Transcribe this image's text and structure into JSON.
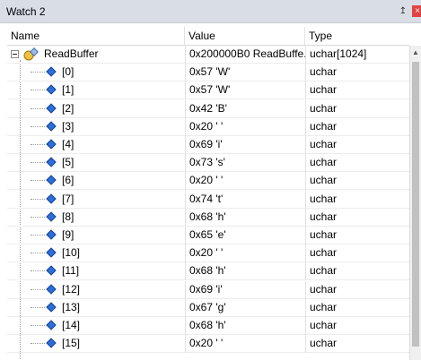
{
  "window": {
    "title": "Watch 2",
    "pin_glyph": "↥",
    "close_glyph": "×"
  },
  "columns": {
    "name": "Name",
    "value": "Value",
    "type": "Type"
  },
  "root": {
    "name": "ReadBuffer",
    "value": "0x200000B0 ReadBuffe...",
    "type": "uchar[1024]"
  },
  "items": [
    {
      "name": "[0]",
      "value": "0x57 'W'",
      "type": "uchar"
    },
    {
      "name": "[1]",
      "value": "0x57 'W'",
      "type": "uchar"
    },
    {
      "name": "[2]",
      "value": "0x42 'B'",
      "type": "uchar"
    },
    {
      "name": "[3]",
      "value": "0x20 ' '",
      "type": "uchar"
    },
    {
      "name": "[4]",
      "value": "0x69 'i'",
      "type": "uchar"
    },
    {
      "name": "[5]",
      "value": "0x73 's'",
      "type": "uchar"
    },
    {
      "name": "[6]",
      "value": "0x20 ' '",
      "type": "uchar"
    },
    {
      "name": "[7]",
      "value": "0x74 't'",
      "type": "uchar"
    },
    {
      "name": "[8]",
      "value": "0x68 'h'",
      "type": "uchar"
    },
    {
      "name": "[9]",
      "value": "0x65 'e'",
      "type": "uchar"
    },
    {
      "name": "[10]",
      "value": "0x20 ' '",
      "type": "uchar"
    },
    {
      "name": "[11]",
      "value": "0x68 'h'",
      "type": "uchar"
    },
    {
      "name": "[12]",
      "value": "0x69 'i'",
      "type": "uchar"
    },
    {
      "name": "[13]",
      "value": "0x67 'g'",
      "type": "uchar"
    },
    {
      "name": "[14]",
      "value": "0x68 'h'",
      "type": "uchar"
    },
    {
      "name": "[15]",
      "value": "0x20 ' '",
      "type": "uchar"
    }
  ],
  "icons": {
    "expander": "collapse-icon",
    "root": "structure-icon",
    "item": "variable-icon"
  },
  "colors": {
    "titlebar": "#d9dde6",
    "close": "#e04343",
    "item_icon": "#2d6fd6"
  }
}
